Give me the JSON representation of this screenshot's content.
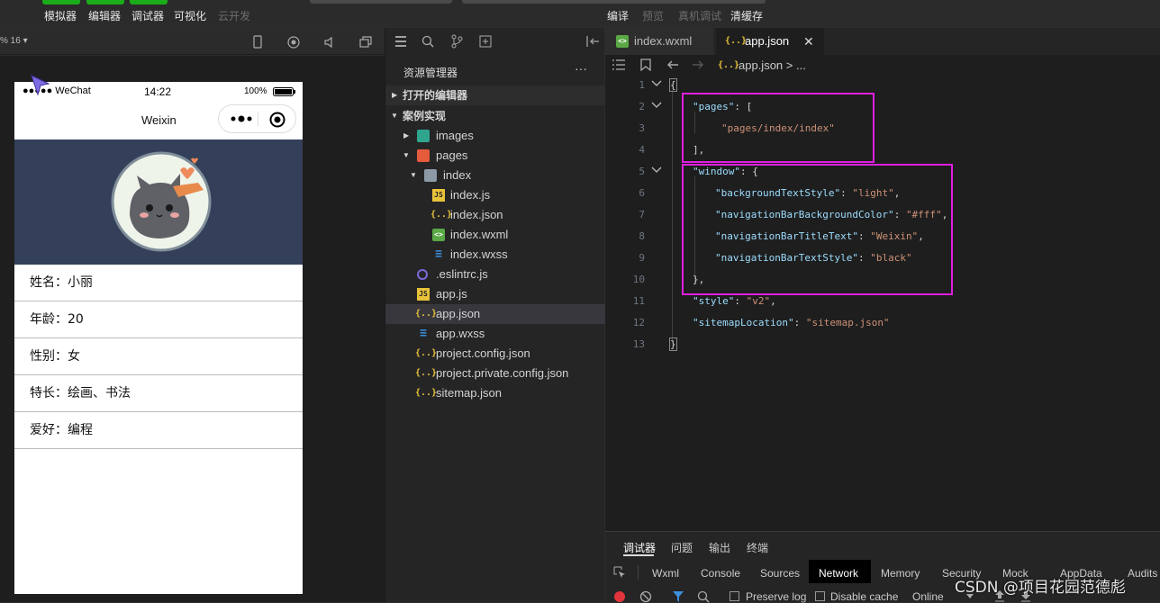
{
  "toolbar": {
    "simulator": "模拟器",
    "editor": "编辑器",
    "debugger": "调试器",
    "visualize": "可视化",
    "cloud": "云开发",
    "compile": "编译",
    "preview": "预览",
    "real_debug": "真机调试",
    "clear_cache": "清缓存"
  },
  "simulator": {
    "zoom": "% 16 ▾",
    "status": {
      "carrier": "●●●●● WeChat",
      "time": "14:22",
      "battery": "100%"
    },
    "nav_title": "Weixin",
    "rows": [
      {
        "label": "姓名：小丽"
      },
      {
        "label": "年龄：20"
      },
      {
        "label": "性别：女"
      },
      {
        "label": "特长：绘画、书法"
      },
      {
        "label": "爱好：编程"
      }
    ]
  },
  "explorer": {
    "title": "资源管理器",
    "more": "···",
    "open_editors": "打开的编辑器",
    "project": "案例实现",
    "items": [
      {
        "name": "images"
      },
      {
        "name": "pages"
      },
      {
        "name": "index"
      },
      {
        "name": "index.js"
      },
      {
        "name": "index.json"
      },
      {
        "name": "index.wxml"
      },
      {
        "name": "index.wxss"
      },
      {
        "name": ".eslintrc.js"
      },
      {
        "name": "app.js"
      },
      {
        "name": "app.json"
      },
      {
        "name": "app.wxss"
      },
      {
        "name": "project.config.json"
      },
      {
        "name": "project.private.config.json"
      },
      {
        "name": "sitemap.json"
      }
    ]
  },
  "editor": {
    "tabs": [
      {
        "label": "index.wxml"
      },
      {
        "label": "app.json"
      }
    ],
    "breadcrumb": "app.json > ...",
    "line_numbers": [
      "1",
      "2",
      "3",
      "4",
      "5",
      "6",
      "7",
      "8",
      "9",
      "10",
      "11",
      "12",
      "13"
    ]
  },
  "code": {
    "l1": "{",
    "l2_k": "\"pages\"",
    "l2_p": ": [",
    "l3_s": "\"pages/index/index\"",
    "l4_p": "],",
    "l5_k": "\"window\"",
    "l5_p": ": {",
    "l6_k": "\"backgroundTextStyle\"",
    "l6_p": ": ",
    "l6_s": "\"light\"",
    "l6_c": ",",
    "l7_k": "\"navigationBarBackgroundColor\"",
    "l7_p": ": ",
    "l7_s": "\"#fff\"",
    "l7_c": ",",
    "l8_k": "\"navigationBarTitleText\"",
    "l8_p": ": ",
    "l8_s": "\"Weixin\"",
    "l8_c": ",",
    "l9_k": "\"navigationBarTextStyle\"",
    "l9_p": ": ",
    "l9_s": "\"black\"",
    "l10_p": "},",
    "l11_k": "\"style\"",
    "l11_p": ": ",
    "l11_s": "\"v2\"",
    "l11_c": ",",
    "l12_k": "\"sitemapLocation\"",
    "l12_p": ": ",
    "l12_s": "\"sitemap.json\"",
    "l13": "}"
  },
  "debug": {
    "top_tabs": [
      "调试器",
      "问题",
      "输出",
      "终端"
    ],
    "sub_tabs": [
      "Wxml",
      "Console",
      "Sources",
      "Network",
      "Memory",
      "Security",
      "Mock",
      "AppData",
      "Audits"
    ],
    "preserve_log": "Preserve log",
    "disable_cache": "Disable cache",
    "online": "Online"
  },
  "watermark": "CSDN @项目花园范德彪",
  "colors": {
    "accent_green": "#1aad19",
    "highlight_box": "#e01ee0",
    "key": "#9cdcfe",
    "string": "#ce9178"
  }
}
